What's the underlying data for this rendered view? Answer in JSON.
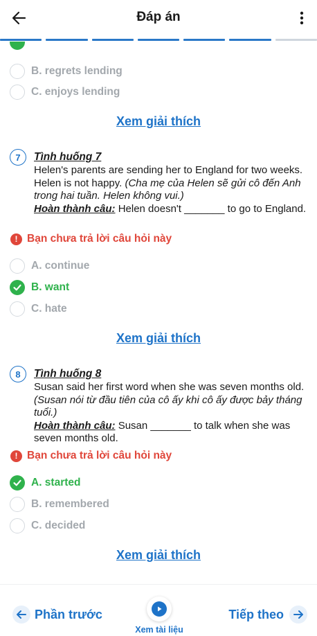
{
  "header": {
    "title": "Đáp án",
    "progress_segments": [
      true,
      true,
      true,
      true,
      true,
      true,
      false
    ]
  },
  "partial_question": {
    "options": [
      {
        "label": "B. regrets lending",
        "state": "unselected"
      },
      {
        "label": "C. enjoys lending",
        "state": "unselected"
      }
    ],
    "explain_link": "Xem giải thích"
  },
  "questions": [
    {
      "number": "7",
      "title": "Tình huống 7",
      "body_en": "Helen's parents are sending her to England for two weeks. Helen is not happy.",
      "body_vi": "(Cha mẹ của Helen sẽ gửi cô đến Anh trong hai tuần. Helen không vui.)",
      "prompt_lead": "Hoàn thành câu:",
      "prompt_text": "Helen doesn't _______ to go to England.",
      "warning": "Bạn chưa trả lời câu hỏi này",
      "options": [
        {
          "label": "A. continue",
          "state": "unselected"
        },
        {
          "label": "B. want",
          "state": "correct"
        },
        {
          "label": "C. hate",
          "state": "unselected"
        }
      ],
      "explain_link": "Xem giải thích"
    },
    {
      "number": "8",
      "title": "Tình huống 8",
      "body_en": "Susan said her first word when she was seven months old.",
      "body_vi": "(Susan nói từ đầu tiên của cô ấy khi cô ấy được bảy tháng tuổi.)",
      "prompt_lead": "Hoàn thành câu:",
      "prompt_text": "Susan _______ to talk when she was seven months old.",
      "warning": "Bạn chưa trả lời câu hỏi này",
      "options": [
        {
          "label": "A. started",
          "state": "correct"
        },
        {
          "label": "B. remembered",
          "state": "unselected"
        },
        {
          "label": "C. decided",
          "state": "unselected"
        }
      ],
      "explain_link": "Xem giải thích"
    }
  ],
  "footer": {
    "prev_label": "Phần trước",
    "doc_label": "Xem tài liệu",
    "next_label": "Tiếp theo"
  },
  "colors": {
    "accent": "#1e73c8",
    "correct": "#2fb24c",
    "warning": "#e0463a",
    "inactive": "#a3a8ad"
  }
}
